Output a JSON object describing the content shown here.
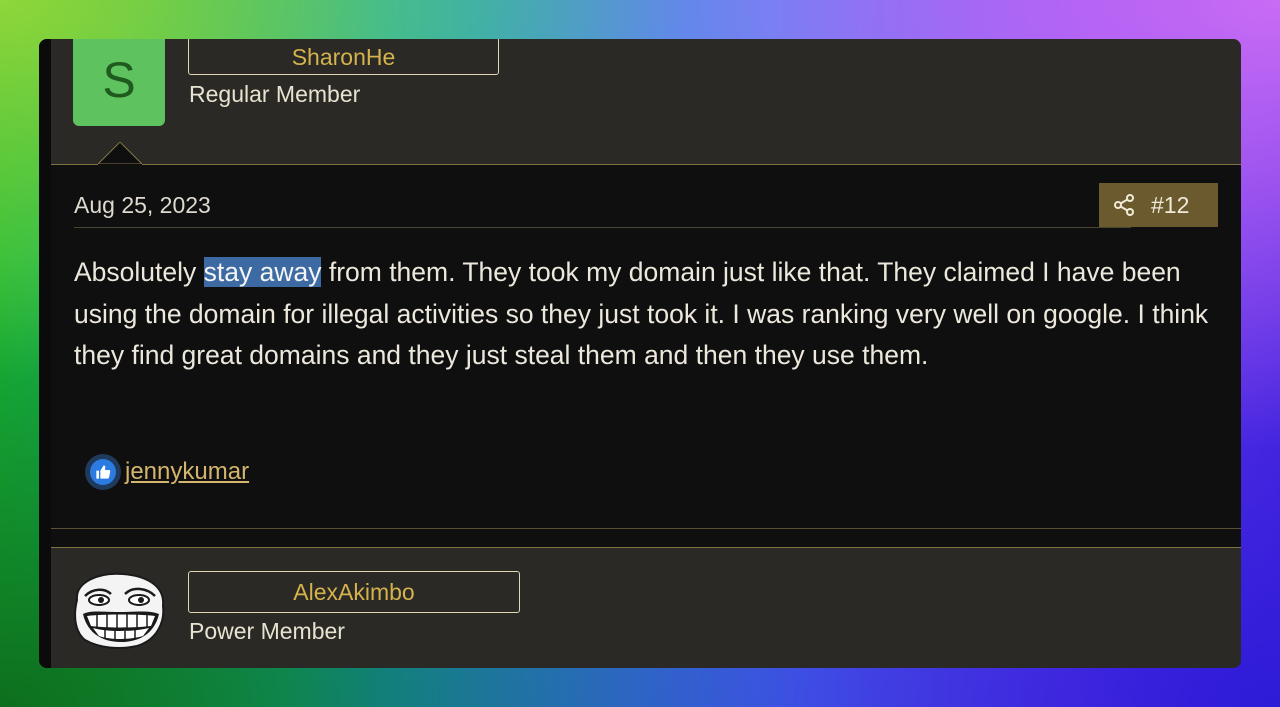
{
  "previous_post_author": {
    "avatar_letter": "S",
    "username": "SharonHe",
    "role": "Regular Member"
  },
  "post": {
    "date": "Aug 25, 2023",
    "number": "#12",
    "share_icon": "share-icon",
    "body_before": "Absolutely ",
    "body_highlight": "stay away",
    "body_after": " from them. They took my domain just like that. They claimed I have been using the domain for illegal activities so they just took it. I was ranking very well on google. I think they find great domains and they just steal them and then they use them.",
    "reaction_icon": "thumbs-up-icon",
    "reactor": "jennykumar"
  },
  "next_post_author": {
    "avatar": "troll-face",
    "username": "AlexAkimbo",
    "role": "Power Member"
  },
  "colors": {
    "highlight": "#3d6aa3",
    "username": "#d4b24c",
    "accent_bar": "#6a5a2e",
    "avatar_bg": "#5ec35e"
  }
}
